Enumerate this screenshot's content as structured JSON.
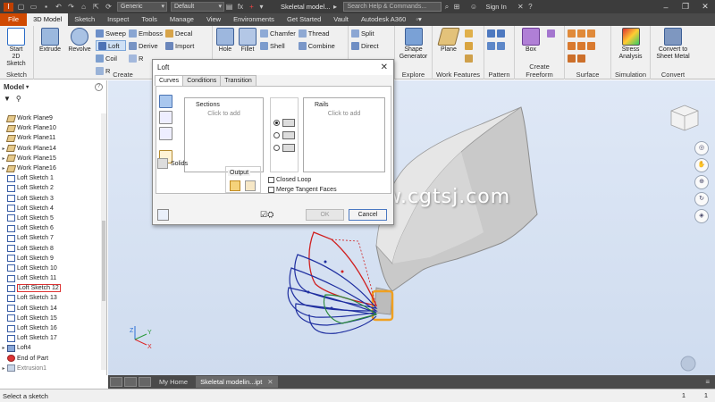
{
  "titlebar": {
    "material": "Generic",
    "appearance": "Default",
    "fx": "fx",
    "doc_title": "Skeletal model...",
    "search_placeholder": "Search Help & Commands...",
    "signin": "Sign In"
  },
  "tabs": [
    "File",
    "3D Model",
    "Sketch",
    "Inspect",
    "Tools",
    "Manage",
    "View",
    "Environments",
    "Get Started",
    "Vault",
    "Autodesk A360"
  ],
  "ribbon": {
    "sketch_panel": {
      "title": "Sketch",
      "start": "Start\n2D Sketch"
    },
    "create_panel": {
      "title": "Create",
      "big": [
        "Extrude",
        "Revolve"
      ],
      "small": [
        "Sweep",
        "Loft",
        "Coil",
        "Rib",
        "Emboss",
        "Derive",
        "Rib",
        "Decal",
        "Import"
      ],
      "col1": [
        "Sweep",
        "Loft",
        "Coil",
        "R"
      ],
      "col2": [
        "Emboss",
        "Derive",
        "R"
      ],
      "col3": [
        "Decal",
        "Import"
      ]
    },
    "modify_panel": {
      "big": [
        "Hole",
        "Fillet"
      ],
      "col1": [
        "Chamfer",
        "Shell"
      ],
      "col2": [
        "Thread",
        "Combine"
      ]
    },
    "split_panel": {
      "col": [
        "Split",
        "Direct"
      ]
    },
    "explore_panel": {
      "title": "Explore",
      "label": "Shape\nGenerator"
    },
    "work_panel": {
      "title": "Work Features",
      "label": "Plane"
    },
    "pattern_panel": {
      "title": "Pattern"
    },
    "freeform_panel": {
      "title": "Create Freeform",
      "label": "Box"
    },
    "surface_panel": {
      "title": "Surface"
    },
    "sim_panel": {
      "title": "Simulation",
      "label": "Stress\nAnalysis"
    },
    "convert_panel": {
      "title": "Convert",
      "label": "Convert to\nSheet Metal"
    }
  },
  "browser": {
    "title": "Model",
    "help": "?",
    "items": [
      {
        "label": "Work Plane9",
        "type": "plane",
        "exp": ""
      },
      {
        "label": "Work Plane10",
        "type": "plane",
        "exp": ""
      },
      {
        "label": "Work Plane11",
        "type": "plane",
        "exp": ""
      },
      {
        "label": "Work Plane14",
        "type": "plane",
        "exp": "▸"
      },
      {
        "label": "Work Plane15",
        "type": "plane",
        "exp": "▸"
      },
      {
        "label": "Work Plane16",
        "type": "plane",
        "exp": "▸"
      },
      {
        "label": "Loft Sketch 1",
        "type": "sketch",
        "exp": ""
      },
      {
        "label": "Loft Sketch 2",
        "type": "sketch",
        "exp": ""
      },
      {
        "label": "Loft Sketch 3",
        "type": "sketch",
        "exp": ""
      },
      {
        "label": "Loft Sketch 4",
        "type": "sketch",
        "exp": ""
      },
      {
        "label": "Loft Sketch 5",
        "type": "sketch",
        "exp": ""
      },
      {
        "label": "Loft Sketch 6",
        "type": "sketch",
        "exp": ""
      },
      {
        "label": "Loft Sketch 7",
        "type": "sketch",
        "exp": ""
      },
      {
        "label": "Loft Sketch 8",
        "type": "sketch",
        "exp": ""
      },
      {
        "label": "Loft Sketch 9",
        "type": "sketch",
        "exp": ""
      },
      {
        "label": "Loft Sketch 10",
        "type": "sketch",
        "exp": ""
      },
      {
        "label": "Loft Sketch 11",
        "type": "sketch",
        "exp": ""
      },
      {
        "label": "Loft Sketch 12",
        "type": "sketch",
        "exp": "",
        "hl": true
      },
      {
        "label": "Loft Sketch 13",
        "type": "sketch",
        "exp": ""
      },
      {
        "label": "Loft Sketch 14",
        "type": "sketch",
        "exp": ""
      },
      {
        "label": "Loft Sketch 15",
        "type": "sketch",
        "exp": ""
      },
      {
        "label": "Loft Sketch 16",
        "type": "sketch",
        "exp": ""
      },
      {
        "label": "Loft Sketch 17",
        "type": "sketch",
        "exp": ""
      },
      {
        "label": "Loft4",
        "type": "loft",
        "exp": "▸"
      },
      {
        "label": "End of Part",
        "type": "end",
        "exp": ""
      },
      {
        "label": "Extrusion1",
        "type": "ext",
        "exp": "▸",
        "dim": true
      }
    ]
  },
  "loft_dialog": {
    "title": "Loft",
    "tabs": [
      "Curves",
      "Conditions",
      "Transition"
    ],
    "sections_header": "Sections",
    "sections_placeholder": "Click to add",
    "rails_header": "Rails",
    "rails_placeholder": "Click to add",
    "solids_label": "Solids",
    "output_label": "Output",
    "closed_loop": "Closed Loop",
    "merge_tangent": "Merge Tangent Faces",
    "ok": "OK",
    "cancel": "Cancel"
  },
  "doc_tabs": {
    "home": "My Home",
    "doc": "Skeletal modelin...ipt"
  },
  "status": {
    "message": "Select a sketch",
    "count1": "1",
    "count2": "1"
  },
  "watermark": "www.cgtsj.com",
  "colors": {
    "file_tab": "#d04a02",
    "sketch_blue": "#1f2fa0",
    "sketch_red": "#d02020",
    "highlight_orange": "#f0a020"
  }
}
